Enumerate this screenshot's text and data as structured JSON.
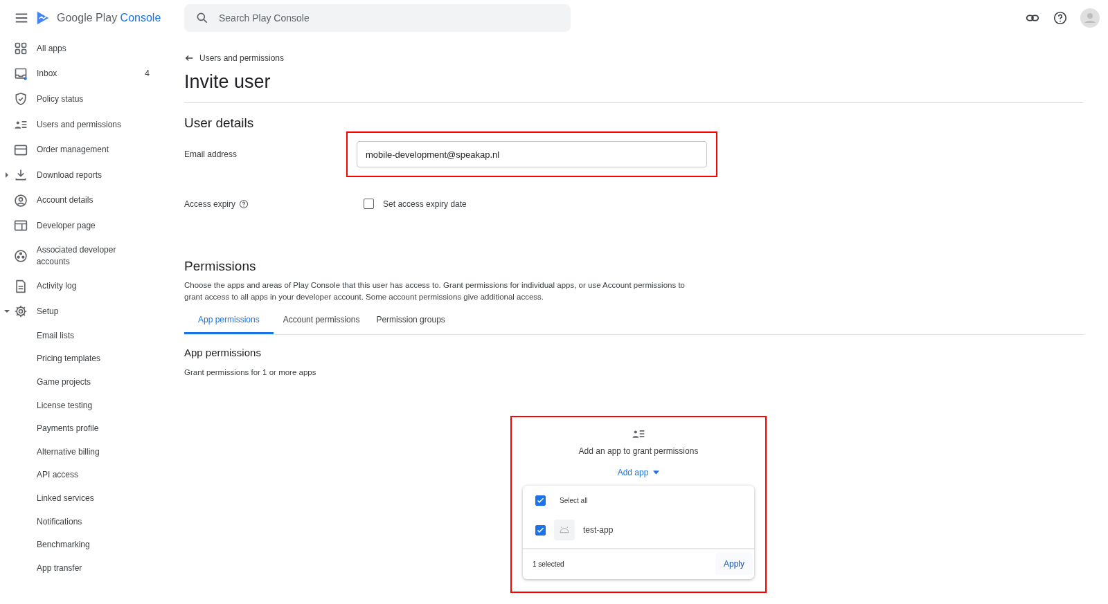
{
  "header": {
    "logo": {
      "brand": "Google Play",
      "product": "Console"
    },
    "search": {
      "placeholder": "Search Play Console"
    }
  },
  "sidebar": {
    "items": [
      {
        "label": "All apps",
        "selected": false
      },
      {
        "label": "Inbox",
        "selected": false,
        "count": "4"
      },
      {
        "label": "Policy status",
        "selected": false
      },
      {
        "label": "Users and permissions",
        "selected": false
      },
      {
        "label": "Order management",
        "selected": false
      },
      {
        "label": "Download reports",
        "selected": false,
        "expanded": false
      },
      {
        "label": "Account details",
        "selected": false
      },
      {
        "label": "Developer page",
        "selected": false
      },
      {
        "label": "Associated developer accounts",
        "selected": false
      },
      {
        "label": "Activity log",
        "selected": false
      },
      {
        "label": "Setup",
        "selected": false,
        "expanded": true,
        "children": [
          {
            "label": "Email lists",
            "selected": false
          },
          {
            "label": "Pricing templates",
            "selected": false
          },
          {
            "label": "Game projects",
            "selected": false
          },
          {
            "label": "License testing",
            "selected": false
          },
          {
            "label": "Payments profile",
            "selected": false
          },
          {
            "label": "Alternative billing",
            "selected": false
          },
          {
            "label": "API access",
            "selected": false
          },
          {
            "label": "Linked services",
            "selected": false
          },
          {
            "label": "Notifications",
            "selected": false
          },
          {
            "label": "Benchmarking",
            "selected": false
          },
          {
            "label": "App transfer",
            "selected": false
          }
        ]
      }
    ]
  },
  "breadcrumb": "Users and permissions",
  "title": "Invite user",
  "user_details": {
    "heading": "User details",
    "email": {
      "label": "Email address",
      "value": "mobile-development@speakap.nl"
    },
    "access_expiry": {
      "label": "Access expiry",
      "checkbox": {
        "label": "Set access expiry date",
        "checked": false
      }
    }
  },
  "permissions": {
    "heading": "Permissions",
    "description": "Choose the apps and areas of Play Console that this user has access to. Grant permissions for individual apps, or use Account permissions to grant access to all apps in your developer account. Some account permissions give additional access.",
    "tabs": [
      {
        "label": "App permissions",
        "selected": true
      },
      {
        "label": "Account permissions",
        "selected": false
      },
      {
        "label": "Permission groups",
        "selected": false
      }
    ],
    "section": {
      "heading": "App permissions",
      "subtitle": "Grant permissions for 1 or more apps"
    },
    "empty_state": {
      "message": "Add an app to grant permissions",
      "add_button": "Add app"
    },
    "app_menu": {
      "select_all": {
        "label": "Select all",
        "checked": true
      },
      "apps": [
        {
          "name": "test-app",
          "checked": true
        }
      ],
      "footer": {
        "count": "1 selected",
        "apply": "Apply"
      }
    }
  }
}
